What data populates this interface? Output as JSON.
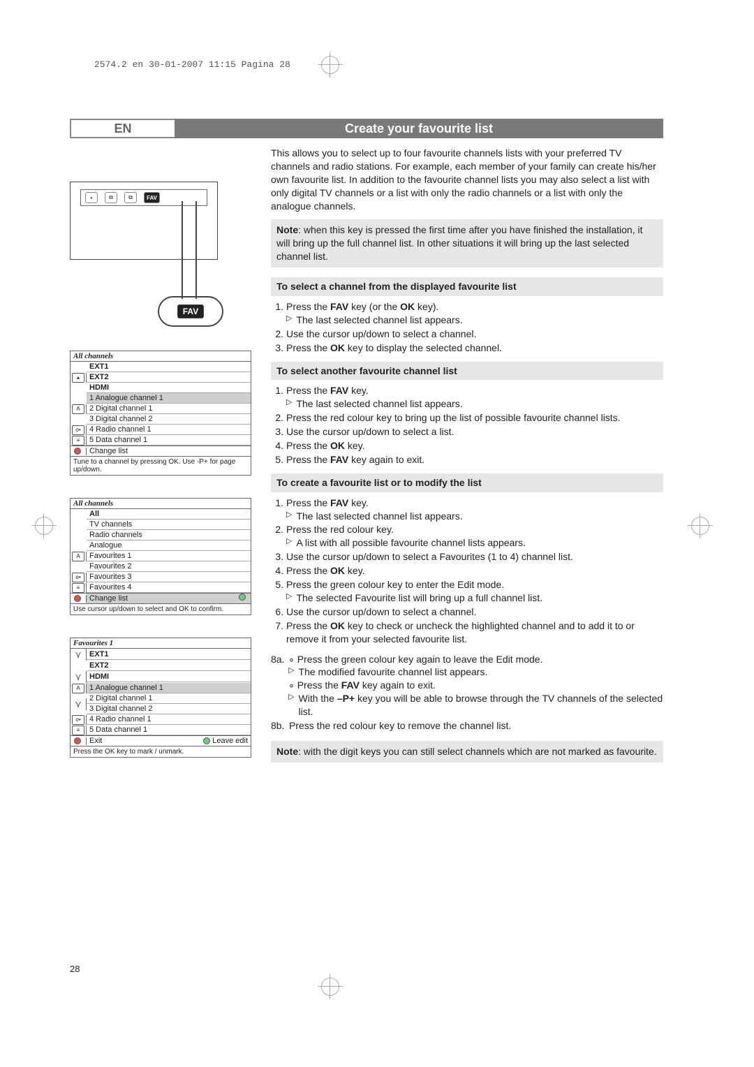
{
  "slug": "2574.2 en  30-01-2007  11:15  Pagina 28",
  "lang": "EN",
  "title": "Create your favourite list",
  "intro": "This allows you to select up to four favourite channels lists with your preferred TV channels and radio stations. For example, each member of your family can create his/her own favourite list. In addition to the favourite channel lists you may also select a list with only digital TV channels or a list with only the radio channels or a list with only the analogue channels.",
  "note1_prefix": "Note",
  "note1": ": when this key is pressed the first time after you have finished the installation, it will bring up the full channel list. In other situations it will bring up the last selected channel list.",
  "sec1_title": "To select a channel from the displayed favourite list",
  "sec1_steps": [
    "Press the FAV key (or the OK key).",
    "Use the cursor up/down to select a channel.",
    "Press the OK key to display the selected channel."
  ],
  "sec1_sub1": "The last selected channel list appears.",
  "sec2_title": "To select another favourite channel list",
  "sec2_steps": [
    "Press the FAV key.",
    "Press the red colour key to bring up the list of possible favourite channel lists.",
    "Use the cursor up/down to select a list.",
    "Press the OK key.",
    "Press the FAV key again to exit."
  ],
  "sec2_sub1": "The last selected channel list appears.",
  "sec3_title": "To create a favourite list or to modify the list",
  "sec3_steps": [
    "Press the FAV key.",
    "Press the red colour key.",
    "Use the cursor up/down to select a Favourites (1 to 4) channel list.",
    "Press the OK key.",
    "Press the green colour key to enter the Edit mode.",
    "Use the cursor up/down to select a channel.",
    "Press the OK key to check or uncheck the highlighted channel and to add it to or remove it from your selected favourite list."
  ],
  "sec3_sub1": "The last selected channel list appears.",
  "sec3_sub2": "A list with all possible favourite channel lists appears.",
  "sec3_sub5": "The selected Favourite list will bring up a full channel list.",
  "step8a_label": "8a.",
  "step8a_line": "Press the green colour key again to leave the Edit mode.",
  "step8a_sub1": "The modified favourite channel list appears.",
  "step8a_line2": "Press the FAV key again to exit.",
  "step8a_sub2": "With the –P+ key you will be able to browse through the TV channels of the selected list.",
  "step8b_label": "8b.",
  "step8b_line": "Press the red colour key to remove the channel list.",
  "note2_prefix": "Note",
  "note2": ": with the digit keys you can still select channels which are not marked as favourite.",
  "page_number": "28",
  "panel1": {
    "header": "All channels",
    "ext1": "EXT1",
    "ext2": "EXT2",
    "hdmi": "HDMI",
    "c1": "1 Analogue channel 1",
    "c2": "2 Digital channel 1",
    "c3": "3 Digital channel 2",
    "c4": "4 Radio channel 1",
    "c5": "5 Data channel 1",
    "change": "Change list",
    "footer": "Tune to a channel by pressing OK. Use -P+ for page up/down."
  },
  "panel2": {
    "header": "All channels",
    "i1": "All",
    "i2": "TV channels",
    "i3": "Radio channels",
    "i4": "Analogue",
    "i5": "Favourites 1",
    "i6": "Favourites 2",
    "i7": "Favourites 3",
    "i8": "Favourites 4",
    "change": "Change list",
    "footer": "Use cursor up/down to select and OK to confirm."
  },
  "panel3": {
    "header": "Favourites 1",
    "ext1": "EXT1",
    "ext2": "EXT2",
    "hdmi": "HDMI",
    "c1": "1 Analogue channel 1",
    "c2": "2 Digital channel 1",
    "c3": "3 Digital channel 2",
    "c4": "4 Radio channel 1",
    "c5": "5 Data channel 1",
    "exit": "Exit",
    "leave": "Leave edit",
    "footer": "Press the OK key to mark / unmark."
  },
  "fav_label": "FAV"
}
